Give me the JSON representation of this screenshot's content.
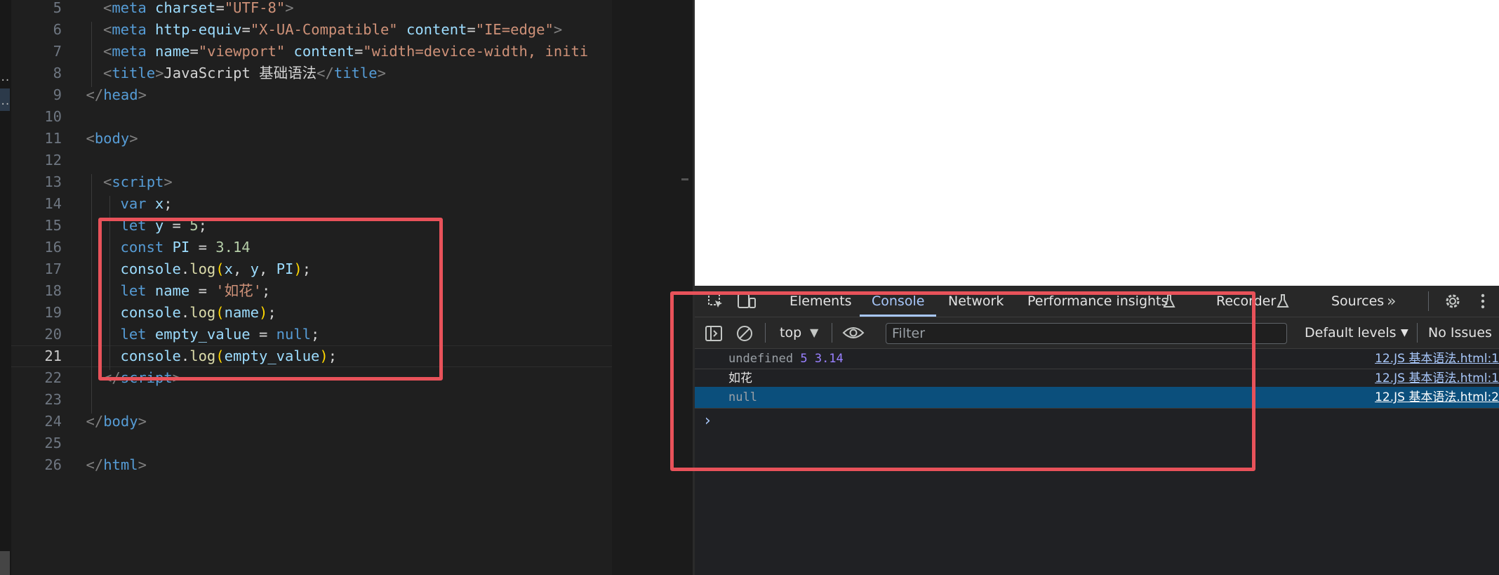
{
  "editor": {
    "lines": [
      {
        "n": "5",
        "tokens": [
          [
            "tag-open",
            "<meta"
          ],
          [
            "attr",
            " charset"
          ],
          [
            "plain",
            "="
          ],
          [
            "str",
            "\"UTF-8\""
          ],
          [
            "br",
            ">"
          ]
        ]
      },
      {
        "n": "6",
        "tokens": [
          [
            "tag-open",
            "<meta"
          ],
          [
            "attr",
            " http-equiv"
          ],
          [
            "plain",
            "="
          ],
          [
            "str",
            "\"X-UA-Compatible\""
          ],
          [
            "attr",
            " content"
          ],
          [
            "plain",
            "="
          ],
          [
            "str",
            "\"IE=edge\""
          ],
          [
            "br",
            ">"
          ]
        ]
      },
      {
        "n": "7",
        "tokens": [
          [
            "tag-open",
            "<meta"
          ],
          [
            "attr",
            " name"
          ],
          [
            "plain",
            "="
          ],
          [
            "str",
            "\"viewport\""
          ],
          [
            "attr",
            " content"
          ],
          [
            "plain",
            "="
          ],
          [
            "str",
            "\"width=device-width, initi"
          ]
        ]
      },
      {
        "n": "8",
        "tokens": [
          [
            "tag-open",
            "<title"
          ],
          [
            "br",
            ">"
          ],
          [
            "plain",
            "JavaScript 基础语法"
          ],
          [
            "tag-open",
            "</title"
          ],
          [
            "br",
            ">"
          ]
        ]
      },
      {
        "n": "9",
        "tokens": [
          [
            "tag-open",
            "</head"
          ],
          [
            "br",
            ">"
          ]
        ]
      },
      {
        "n": "10",
        "tokens": []
      },
      {
        "n": "11",
        "tokens": [
          [
            "tag-open",
            "<body"
          ],
          [
            "br",
            ">"
          ]
        ]
      },
      {
        "n": "12",
        "tokens": []
      },
      {
        "n": "13",
        "tokens": [
          [
            "tag-open",
            "<script"
          ],
          [
            "br",
            ">"
          ]
        ]
      },
      {
        "n": "14",
        "tokens": [
          [
            "kw",
            "var"
          ],
          [
            "plain",
            " "
          ],
          [
            "var",
            "x"
          ],
          [
            "plain",
            ";"
          ]
        ]
      },
      {
        "n": "15",
        "tokens": [
          [
            "kw",
            "let"
          ],
          [
            "plain",
            " "
          ],
          [
            "var",
            "y"
          ],
          [
            "plain",
            " = "
          ],
          [
            "num",
            "5"
          ],
          [
            "plain",
            ";"
          ]
        ]
      },
      {
        "n": "16",
        "tokens": [
          [
            "kw",
            "const"
          ],
          [
            "plain",
            " "
          ],
          [
            "var",
            "PI"
          ],
          [
            "plain",
            " = "
          ],
          [
            "num",
            "3.14"
          ]
        ]
      },
      {
        "n": "17",
        "tokens": [
          [
            "var",
            "console"
          ],
          [
            "plain",
            "."
          ],
          [
            "fn",
            "log"
          ],
          [
            "y",
            "("
          ],
          [
            "var",
            "x"
          ],
          [
            "plain",
            ", "
          ],
          [
            "var",
            "y"
          ],
          [
            "plain",
            ", "
          ],
          [
            "var",
            "PI"
          ],
          [
            "y",
            ")"
          ],
          [
            "plain",
            ";"
          ]
        ]
      },
      {
        "n": "18",
        "tokens": [
          [
            "kw",
            "let"
          ],
          [
            "plain",
            " "
          ],
          [
            "var",
            "name"
          ],
          [
            "plain",
            " = "
          ],
          [
            "str",
            "'如花'"
          ],
          [
            "plain",
            ";"
          ]
        ]
      },
      {
        "n": "19",
        "tokens": [
          [
            "var",
            "console"
          ],
          [
            "plain",
            "."
          ],
          [
            "fn",
            "log"
          ],
          [
            "y",
            "("
          ],
          [
            "var",
            "name"
          ],
          [
            "y",
            ")"
          ],
          [
            "plain",
            ";"
          ]
        ]
      },
      {
        "n": "20",
        "tokens": [
          [
            "kw",
            "let"
          ],
          [
            "plain",
            " "
          ],
          [
            "var",
            "empty_value"
          ],
          [
            "plain",
            " = "
          ],
          [
            "kw",
            "null"
          ],
          [
            "plain",
            ";"
          ]
        ]
      },
      {
        "n": "21",
        "tokens": [
          [
            "var",
            "console"
          ],
          [
            "plain",
            "."
          ],
          [
            "fn",
            "log"
          ],
          [
            "y",
            "("
          ],
          [
            "var",
            "empty_value"
          ],
          [
            "y",
            ")"
          ],
          [
            "plain",
            ";"
          ]
        ]
      },
      {
        "n": "22",
        "tokens": [
          [
            "tag-open",
            "</script"
          ],
          [
            "br",
            ">"
          ]
        ]
      },
      {
        "n": "23",
        "tokens": []
      },
      {
        "n": "24",
        "tokens": [
          [
            "tag-open",
            "</body"
          ],
          [
            "br",
            ">"
          ]
        ]
      },
      {
        "n": "25",
        "tokens": []
      },
      {
        "n": "26",
        "tokens": [
          [
            "tag-open",
            "</html"
          ],
          [
            "br",
            ">"
          ]
        ]
      }
    ]
  },
  "devtools": {
    "tabs": [
      "Elements",
      "Console",
      "Network",
      "Performance insights",
      "Recorder",
      "Sources"
    ],
    "active_tab": "Console",
    "context": "top",
    "filter_placeholder": "Filter",
    "levels": "Default levels",
    "issues": "No Issues",
    "console": [
      {
        "parts": [
          [
            "undefined ",
            "plain"
          ],
          [
            "5 3.14",
            "num"
          ]
        ],
        "source": "12.JS 基本语法.html:1"
      },
      {
        "parts": [
          [
            "如花",
            "plain"
          ]
        ],
        "source": "12.JS 基本语法.html:1"
      },
      {
        "parts": [
          [
            "null",
            "plain"
          ]
        ],
        "source": "12.JS 基本语法.html:2",
        "selected": true
      }
    ],
    "prompt": "›"
  },
  "colors": {
    "annotation": "#e8525a",
    "editor_bg": "#1f1f1f",
    "devtools_bg": "#202124",
    "selected_row": "#0b4f7c",
    "accent": "#a8c7fa"
  },
  "icons": [
    "inspect-icon",
    "device-toolbar-icon",
    "flask-icon",
    "chevron-double-right-icon",
    "gear-icon",
    "more-vertical-icon",
    "sidebar-toggle-icon",
    "clear-console-icon",
    "dropdown-caret-icon",
    "eye-icon",
    "prompt-chevron-icon"
  ]
}
